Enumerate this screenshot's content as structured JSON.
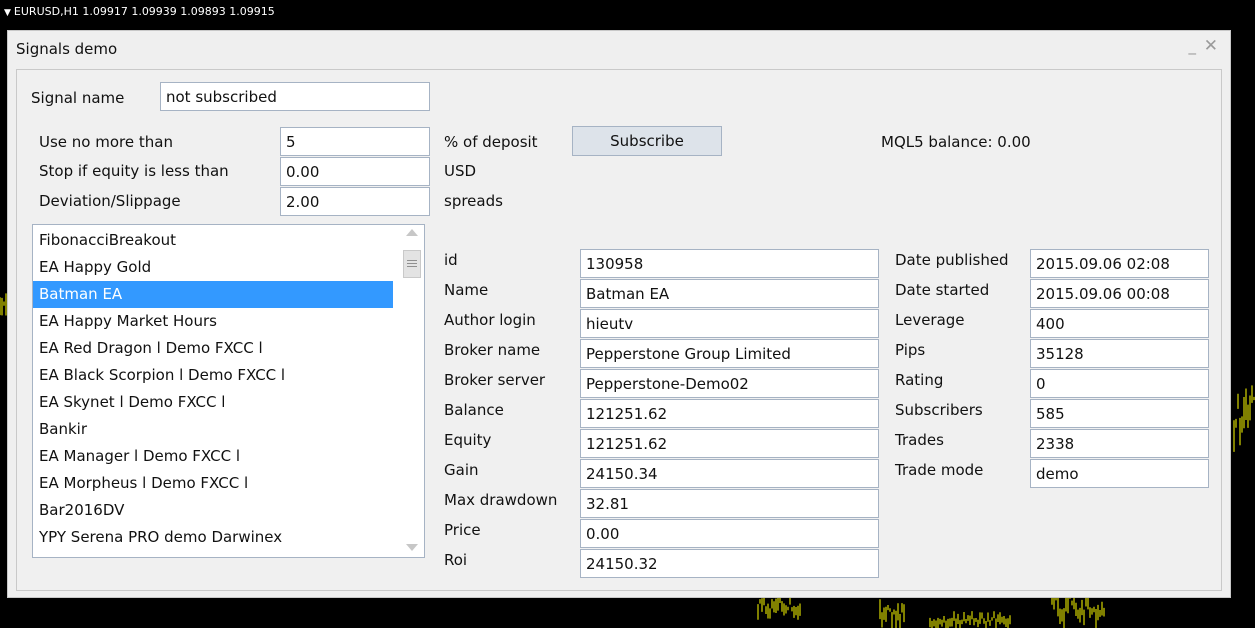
{
  "chart": {
    "header": "EURUSD,H1  1.09917 1.09939 1.09893 1.09915",
    "line_color": "#ffff00",
    "background": "#000000"
  },
  "window": {
    "title": "Signals demo",
    "minimize_glyph": "_",
    "close_glyph": "✕"
  },
  "form": {
    "signal_name_label": "Signal name",
    "signal_name_value": "not subscribed",
    "use_no_more_label": "Use no more than",
    "use_no_more_value": "5",
    "use_no_more_unit": "% of deposit",
    "stop_equity_label": "Stop if equity is less than",
    "stop_equity_value": "0.00",
    "stop_equity_unit": "USD",
    "deviation_label": "Deviation/Slippage",
    "deviation_value": "2.00",
    "deviation_unit": "spreads",
    "subscribe_label": "Subscribe",
    "mql5_balance": "MQL5 balance: 0.00"
  },
  "signals_list": {
    "items": [
      "FibonacciBreakout",
      "EA Happy Gold",
      "Batman EA",
      "EA Happy Market Hours",
      "EA Red Dragon l Demo FXCC l",
      "EA Black Scorpion l Demo FXCC l",
      "EA Skynet l Demo FXCC l",
      "Bankir",
      "EA Manager l Demo FXCC l",
      "EA Morpheus l Demo FXCC l",
      "Bar2016DV",
      "YPY Serena PRO demo Darwinex"
    ],
    "selected_index": 2,
    "selection_color": "#3399ff"
  },
  "details": {
    "left": [
      {
        "label": "id",
        "value": "130958"
      },
      {
        "label": "Name",
        "value": "Batman EA"
      },
      {
        "label": "Author login",
        "value": "hieutv"
      },
      {
        "label": "Broker name",
        "value": "Pepperstone Group Limited"
      },
      {
        "label": "Broker server",
        "value": "Pepperstone-Demo02"
      },
      {
        "label": "Balance",
        "value": "121251.62"
      },
      {
        "label": "Equity",
        "value": "121251.62"
      },
      {
        "label": "Gain",
        "value": "24150.34"
      },
      {
        "label": "Max drawdown",
        "value": "32.81"
      },
      {
        "label": "Price",
        "value": "0.00"
      },
      {
        "label": "Roi",
        "value": "24150.32"
      }
    ],
    "right": [
      {
        "label": "Date published",
        "value": "2015.09.06 02:08"
      },
      {
        "label": "Date started",
        "value": "2015.09.06 00:08"
      },
      {
        "label": "Leverage",
        "value": "400"
      },
      {
        "label": "Pips",
        "value": "35128"
      },
      {
        "label": "Rating",
        "value": "0"
      },
      {
        "label": "Subscribers",
        "value": "585"
      },
      {
        "label": "Trades",
        "value": "2338"
      },
      {
        "label": "Trade mode",
        "value": "demo"
      }
    ]
  }
}
